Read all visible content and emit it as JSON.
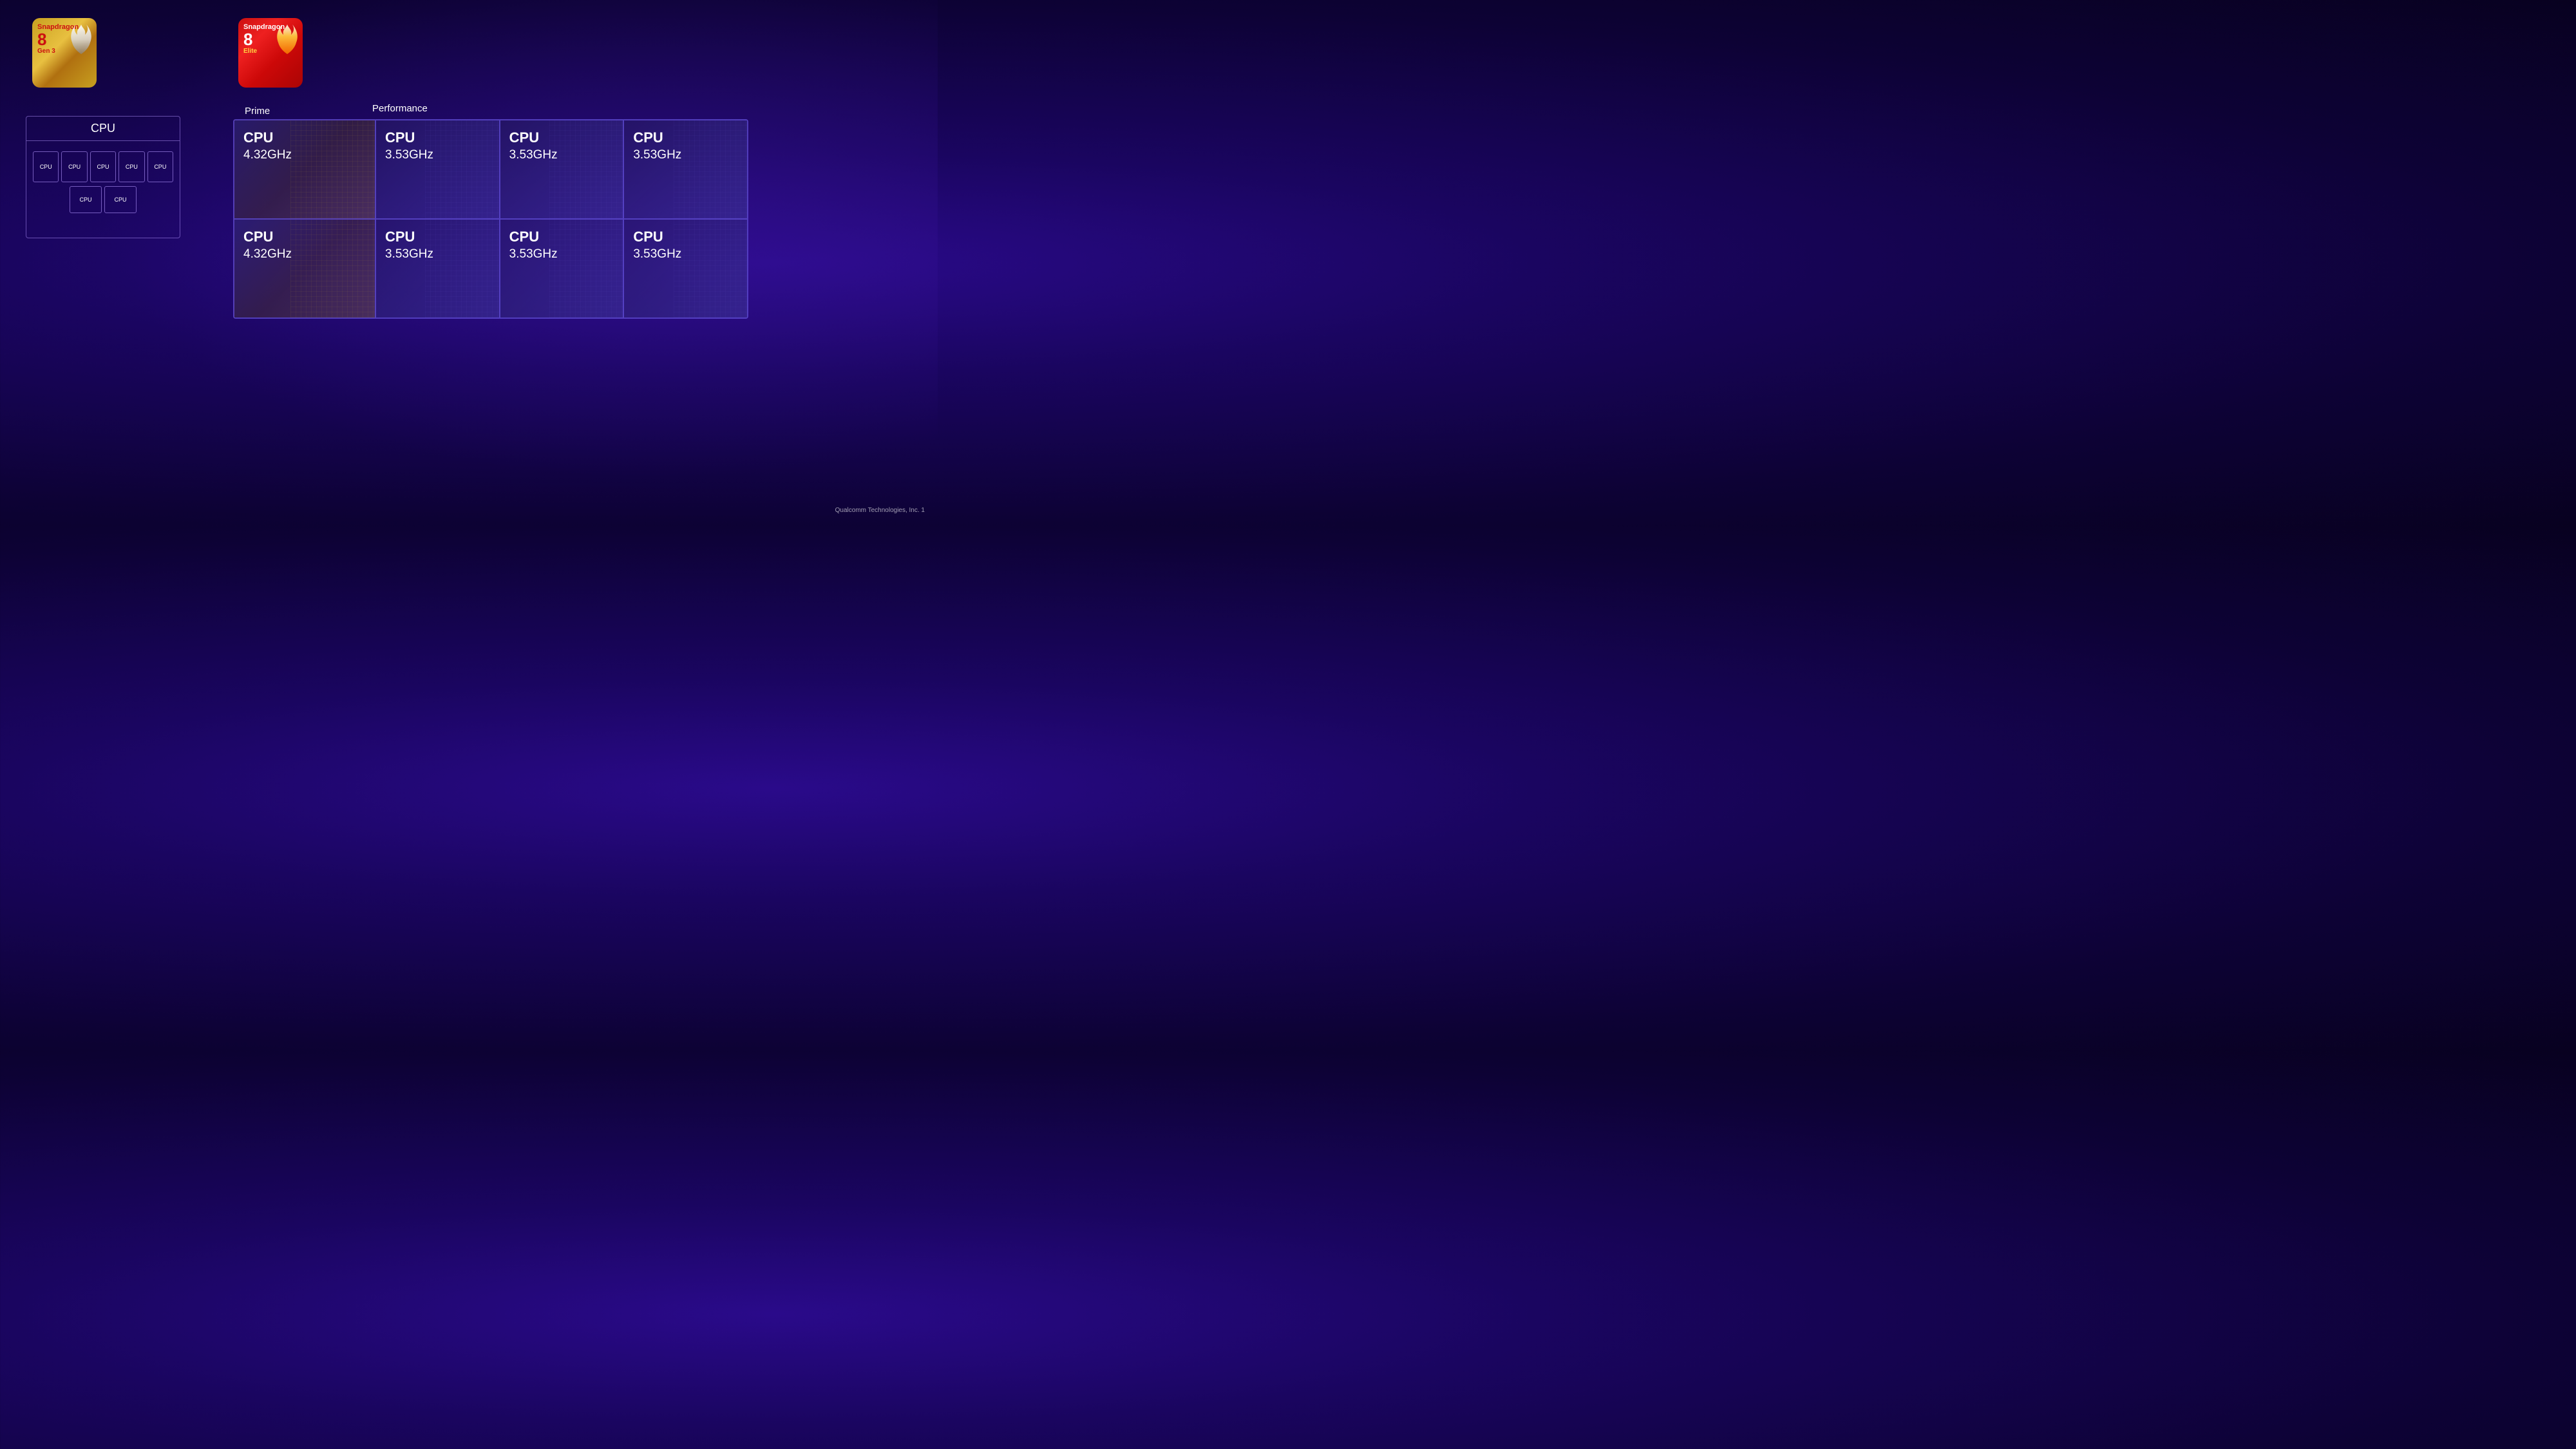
{
  "badges": {
    "gen3": {
      "brand": "Snapdragon",
      "number": "8",
      "sub": "Gen 3"
    },
    "elite": {
      "brand": "Snapdragon",
      "number": "8",
      "sub": "Elite"
    }
  },
  "diagram_left": {
    "title": "CPU",
    "row1": [
      "CPU",
      "CPU",
      "CPU",
      "CPU",
      "CPU"
    ],
    "row2": [
      "CPU",
      "CPU"
    ]
  },
  "labels": {
    "prime": "Prime",
    "performance": "Performance"
  },
  "grid": {
    "rows": [
      [
        {
          "type": "prime",
          "label": "CPU",
          "freq": "4.32GHz"
        },
        {
          "type": "perf",
          "label": "CPU",
          "freq": "3.53GHz"
        },
        {
          "type": "perf",
          "label": "CPU",
          "freq": "3.53GHz"
        },
        {
          "type": "perf",
          "label": "CPU",
          "freq": "3.53GHz"
        }
      ],
      [
        {
          "type": "prime",
          "label": "CPU",
          "freq": "4.32GHz"
        },
        {
          "type": "perf",
          "label": "CPU",
          "freq": "3.53GHz"
        },
        {
          "type": "perf",
          "label": "CPU",
          "freq": "3.53GHz"
        },
        {
          "type": "perf",
          "label": "CPU",
          "freq": "3.53GHz"
        }
      ]
    ]
  },
  "footer": "Qualcomm Technologies, Inc. 1"
}
